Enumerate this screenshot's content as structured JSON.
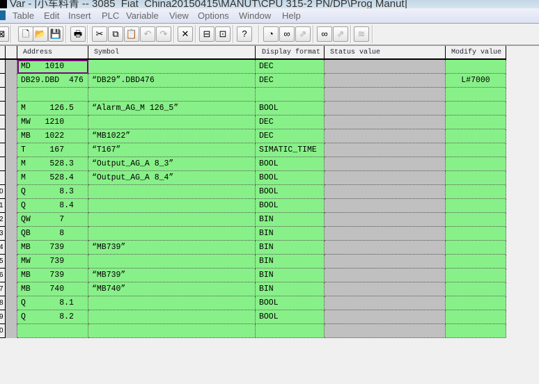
{
  "window": {
    "title": "Var - [小车料青 -- 3085_Fiat_China20150415\\MANUT\\CPU 315-2 PN/DP\\Prog Manut]"
  },
  "menu": [
    "Table",
    "Edit",
    "Insert",
    "PLC",
    "Variable",
    "View",
    "Options",
    "Window",
    "Help"
  ],
  "toolbar": [
    {
      "name": "window-icon",
      "glyph": "⊠"
    },
    {
      "name": "new-icon",
      "glyph": "🗋"
    },
    {
      "name": "open-icon",
      "glyph": "📂"
    },
    {
      "name": "save-icon",
      "glyph": "💾"
    },
    {
      "name": "print-icon",
      "glyph": "🖶"
    },
    {
      "name": "cut-icon",
      "glyph": "✂"
    },
    {
      "name": "copy-icon",
      "glyph": "⧉"
    },
    {
      "name": "paste-icon",
      "glyph": "📋",
      "disabled": true
    },
    {
      "name": "undo-icon",
      "glyph": "↶",
      "disabled": true
    },
    {
      "name": "redo-icon",
      "glyph": "↷",
      "disabled": true
    },
    {
      "name": "delete-icon",
      "glyph": "✕"
    },
    {
      "name": "accessible-nodes-icon",
      "glyph": "⊟"
    },
    {
      "name": "online-icon",
      "glyph": "⊡"
    },
    {
      "name": "help-icon",
      "glyph": "?"
    },
    {
      "name": "trigger-icon",
      "glyph": "◔"
    },
    {
      "name": "monitor-icon",
      "glyph": "∞"
    },
    {
      "name": "modify-icon",
      "glyph": "⇗",
      "disabled": true
    },
    {
      "name": "monitor-once-icon",
      "glyph": "∞"
    },
    {
      "name": "modify-once-icon",
      "glyph": "⇗",
      "disabled": true
    },
    {
      "name": "force-icon",
      "glyph": "≋",
      "disabled": true
    }
  ],
  "columns": {
    "address": "Address",
    "symbol": "Symbol",
    "format": "Display format",
    "status": "Status value",
    "modify": "Modify value"
  },
  "rows": [
    {
      "n": "",
      "address": "MD   1010",
      "symbol": "",
      "format": "DEC",
      "modify": ""
    },
    {
      "n": "",
      "address": "DB29.DBD  476",
      "symbol": "“DB29”.DBD476",
      "format": "DEC",
      "modify": "L#7000"
    },
    {
      "n": "",
      "address": "",
      "symbol": "",
      "format": "",
      "modify": ""
    },
    {
      "n": "",
      "address": "M     126.5",
      "symbol": "“Alarm_AG_M 126_5”",
      "format": "BOOL",
      "modify": ""
    },
    {
      "n": "",
      "address": "MW   1210",
      "symbol": "",
      "format": "DEC",
      "modify": ""
    },
    {
      "n": "",
      "address": "MB   1022",
      "symbol": "“MB1022”",
      "format": "DEC",
      "modify": ""
    },
    {
      "n": "",
      "address": "T     167",
      "symbol": "“T167”",
      "format": "SIMATIC_TIME",
      "modify": ""
    },
    {
      "n": "",
      "address": "M     528.3",
      "symbol": "“Output_AG_A 8_3”",
      "format": "BOOL",
      "modify": ""
    },
    {
      "n": "",
      "address": "M     528.4",
      "symbol": "“Output_AG_A 8_4”",
      "format": "BOOL",
      "modify": ""
    },
    {
      "n": "0",
      "address": "Q       8.3",
      "symbol": "",
      "format": "BOOL",
      "modify": ""
    },
    {
      "n": "1",
      "address": "Q       8.4",
      "symbol": "",
      "format": "BOOL",
      "modify": ""
    },
    {
      "n": "2",
      "address": "QW      7",
      "symbol": "",
      "format": "BIN",
      "modify": ""
    },
    {
      "n": "3",
      "address": "QB      8",
      "symbol": "",
      "format": "BIN",
      "modify": ""
    },
    {
      "n": "4",
      "address": "MB    739",
      "symbol": "“MB739”",
      "format": "BIN",
      "modify": ""
    },
    {
      "n": "5",
      "address": "MW    739",
      "symbol": "",
      "format": "BIN",
      "modify": ""
    },
    {
      "n": "6",
      "address": "MB    739",
      "symbol": "“MB739”",
      "format": "BIN",
      "modify": ""
    },
    {
      "n": "7",
      "address": "MB    740",
      "symbol": "“MB740”",
      "format": "BIN",
      "modify": ""
    },
    {
      "n": "8",
      "address": "Q       8.1",
      "symbol": "",
      "format": "BOOL",
      "modify": ""
    },
    {
      "n": "9",
      "address": "Q       8.2",
      "symbol": "",
      "format": "BOOL",
      "modify": ""
    },
    {
      "n": "0",
      "address": "",
      "symbol": "",
      "format": "",
      "modify": ""
    }
  ]
}
